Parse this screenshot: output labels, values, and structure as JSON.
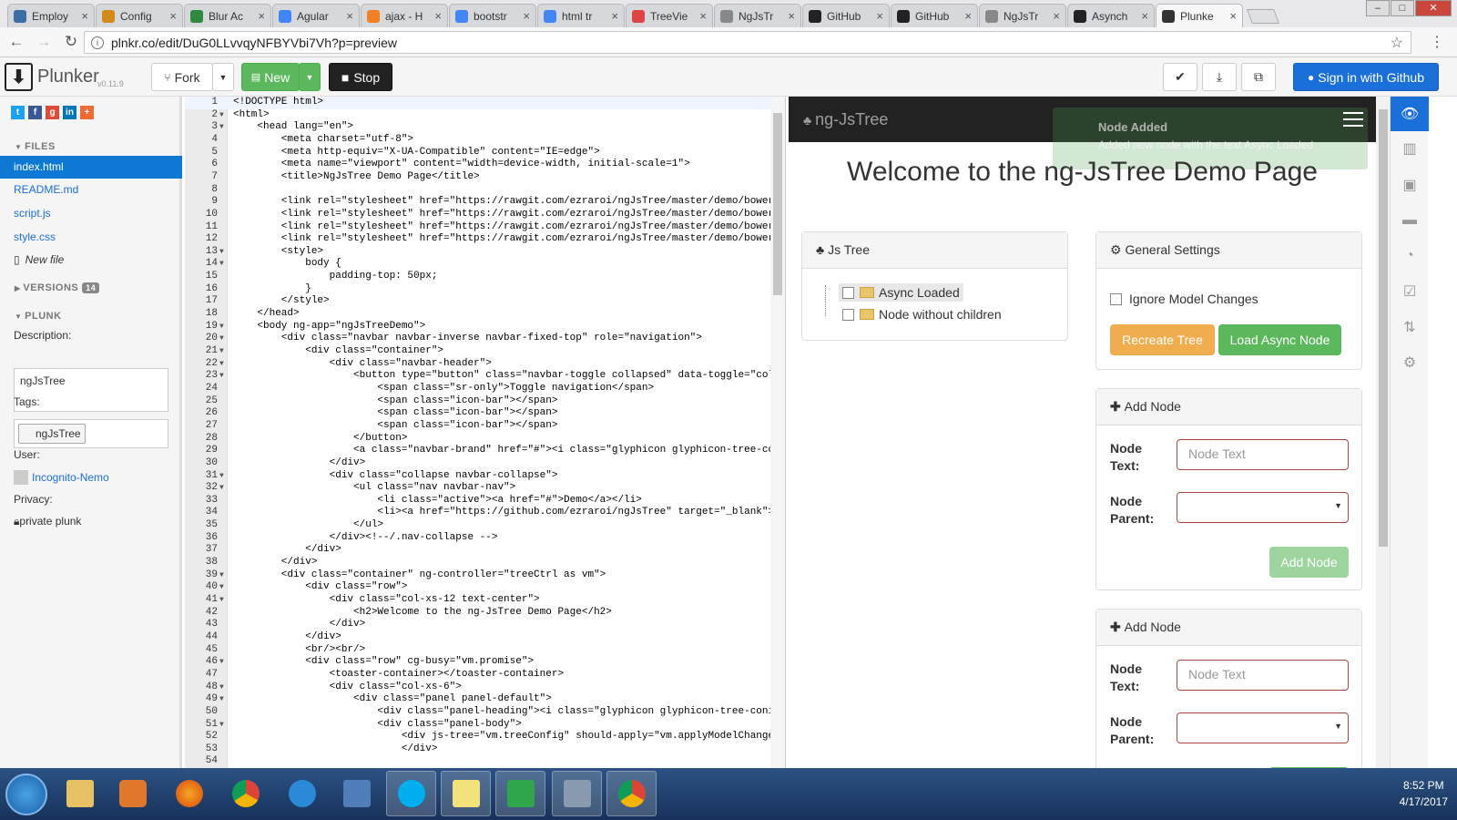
{
  "browser": {
    "tabs": [
      {
        "label": "Employ",
        "fav_color": "#3a6ea5"
      },
      {
        "label": "Config",
        "fav_color": "#d48a1b"
      },
      {
        "label": "Blur Ac",
        "fav_color": "#2d8a3f"
      },
      {
        "label": "Agular",
        "fav_color": "#4285f4"
      },
      {
        "label": "ajax - H",
        "fav_color": "#f48024"
      },
      {
        "label": "bootstr",
        "fav_color": "#4285f4"
      },
      {
        "label": "html tr",
        "fav_color": "#4285f4"
      },
      {
        "label": "TreeVie",
        "fav_color": "#e04343"
      },
      {
        "label": "NgJsTr",
        "fav_color": "#888888"
      },
      {
        "label": "GitHub",
        "fav_color": "#222222"
      },
      {
        "label": "GitHub",
        "fav_color": "#222222"
      },
      {
        "label": "NgJsTr",
        "fav_color": "#888888"
      },
      {
        "label": "Asynch",
        "fav_color": "#222222"
      },
      {
        "label": "Plunke",
        "fav_color": "#333333"
      }
    ],
    "tab_close": "×",
    "url": "plnkr.co/edit/DuG0LLvvqyNFBYVbi7Vh?p=preview"
  },
  "plunker": {
    "brand": "Plunker",
    "version": "v0.11.9",
    "fork_label": "Fork",
    "new_label": "New",
    "stop_label": "Stop",
    "signin_label": "Sign in with Github"
  },
  "sidebar": {
    "files_heading": "FILES",
    "files": [
      "index.html",
      "README.md",
      "script.js",
      "style.css"
    ],
    "new_file": "New file",
    "versions_heading": "VERSIONS",
    "versions_count": "14",
    "plunk_heading": "PLUNK",
    "description_label": "Description:",
    "description_value": "ngJsTree",
    "tags_label": "Tags:",
    "tag": "ngJsTree",
    "user_label": "User:",
    "user_name": "Incognito-Nemo",
    "privacy_label": "Privacy:",
    "privacy_value": "private plunk"
  },
  "editor": {
    "lines": [
      "<!DOCTYPE html>",
      "<html>",
      "    <head lang=\"en\">",
      "        <meta charset=\"utf-8\">",
      "        <meta http-equiv=\"X-UA-Compatible\" content=\"IE=edge\">",
      "        <meta name=\"viewport\" content=\"width=device-width, initial-scale=1\">",
      "        <title>NgJsTree Demo Page</title>",
      "",
      "        <link rel=\"stylesheet\" href=\"https://rawgit.com/ezraroi/ngJsTree/master/demo/bower_c",
      "        <link rel=\"stylesheet\" href=\"https://rawgit.com/ezraroi/ngJsTree/master/demo/bower_c",
      "        <link rel=\"stylesheet\" href=\"https://rawgit.com/ezraroi/ngJsTree/master/demo/bower_c",
      "        <link rel=\"stylesheet\" href=\"https://rawgit.com/ezraroi/ngJsTree/master/demo/bower_c",
      "        <style>",
      "            body {",
      "                padding-top: 50px;",
      "            }",
      "        </style>",
      "    </head>",
      "    <body ng-app=\"ngJsTreeDemo\">",
      "        <div class=\"navbar navbar-inverse navbar-fixed-top\" role=\"navigation\">",
      "            <div class=\"container\">",
      "                <div class=\"navbar-header\">",
      "                    <button type=\"button\" class=\"navbar-toggle collapsed\" data-toggle=\"colla",
      "                        <span class=\"sr-only\">Toggle navigation</span>",
      "                        <span class=\"icon-bar\"></span>",
      "                        <span class=\"icon-bar\"></span>",
      "                        <span class=\"icon-bar\"></span>",
      "                    </button>",
      "                    <a class=\"navbar-brand\" href=\"#\"><i class=\"glyphicon glyphicon-tree-coni",
      "                </div>",
      "                <div class=\"collapse navbar-collapse\">",
      "                    <ul class=\"nav navbar-nav\">",
      "                        <li class=\"active\"><a href=\"#\">Demo</a></li>",
      "                        <li><a href=\"https://github.com/ezraroi/ngJsTree\" target=\"_blank\">Gi",
      "                    </ul>",
      "                </div><!--/.nav-collapse -->",
      "            </div>",
      "        </div>",
      "        <div class=\"container\" ng-controller=\"treeCtrl as vm\">",
      "            <div class=\"row\">",
      "                <div class=\"col-xs-12 text-center\">",
      "                    <h2>Welcome to the ng-JsTree Demo Page</h2>",
      "                </div>",
      "            </div>",
      "            <br/><br/>",
      "            <div class=\"row\" cg-busy=\"vm.promise\">",
      "                <toaster-container></toaster-container>",
      "                <div class=\"col-xs-6\">",
      "                    <div class=\"panel panel-default\">",
      "                        <div class=\"panel-heading\"><i class=\"glyphicon glyphicon-tree-conife",
      "                        <div class=\"panel-body\">",
      "                            <div js-tree=\"vm.treeConfig\" should-apply=\"vm.applyModelChanges(",
      "                            </div>",
      ""
    ],
    "fold_lines": [
      2,
      3,
      13,
      14,
      19,
      20,
      21,
      22,
      23,
      31,
      32,
      39,
      40,
      41,
      46,
      48,
      49,
      51
    ]
  },
  "preview": {
    "brand": "ng-JsTree",
    "toast_title": "Node Added",
    "toast_body": "Added new node with the text Async Loaded",
    "heading": "Welcome to the ng-JsTree Demo Page",
    "tree_panel": {
      "title": "Js Tree",
      "nodes": [
        "Async Loaded",
        "Node without children"
      ]
    },
    "settings_panel": {
      "title": "General Settings",
      "checkbox_label": "Ignore Model Changes",
      "recreate_label": "Recreate Tree",
      "load_label": "Load Async Node"
    },
    "add_panel_1": {
      "title": "Add Node",
      "text_label": "Node Text:",
      "text_placeholder": "Node Text",
      "parent_label": "Node Parent:",
      "button_label": "Add Node"
    },
    "add_panel_2": {
      "title": "Add Node",
      "text_label": "Node Text:",
      "text_placeholder": "Node Text",
      "parent_label": "Node Parent:"
    }
  },
  "taskbar": {
    "time": "8:52 PM",
    "date": "4/17/2017"
  },
  "colors": {
    "accent_blue": "#1a6fd8",
    "plunker_green": "#5cb85c",
    "warning_orange": "#f0ad4e",
    "success_green": "#5cb85c",
    "error_border": "#a94442"
  }
}
